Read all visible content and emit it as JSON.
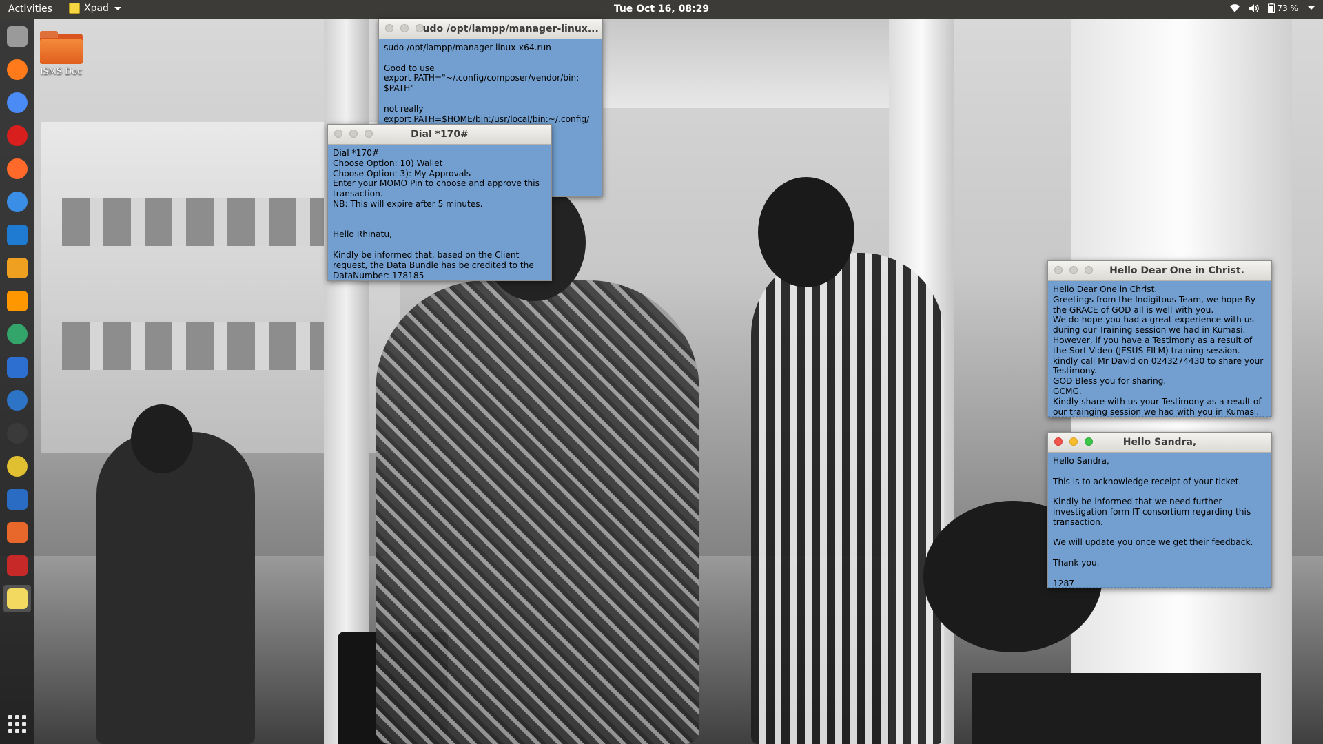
{
  "top_bar": {
    "activities": "Activities",
    "app_name": "Xpad",
    "clock": "Tue Oct 16, 08:29",
    "battery": "73 %",
    "icons": [
      "wifi-icon",
      "volume-icon",
      "battery-icon",
      "system-menu-caret-icon"
    ]
  },
  "dock": {
    "items": [
      {
        "name": "files",
        "color": "#9a9a9a"
      },
      {
        "name": "firefox",
        "color": "#ff7a1a"
      },
      {
        "name": "chrome",
        "color": "#4b8bf5"
      },
      {
        "name": "opera",
        "color": "#d91e1e"
      },
      {
        "name": "brave-compass",
        "color": "#ff6a2b"
      },
      {
        "name": "remmina",
        "color": "#3a8ee6"
      },
      {
        "name": "vscode",
        "color": "#1f7ad1"
      },
      {
        "name": "layers-app",
        "color": "#f0a020"
      },
      {
        "name": "sublime-text",
        "color": "#ff9800"
      },
      {
        "name": "network-app",
        "color": "#33a56b"
      },
      {
        "name": "system-monitor",
        "color": "#2c6fd1"
      },
      {
        "name": "thunderbird",
        "color": "#2d74c7"
      },
      {
        "name": "inkscape",
        "color": "#3a3a3a"
      },
      {
        "name": "rhythmbox",
        "color": "#e0c030"
      },
      {
        "name": "libreoffice-writer",
        "color": "#2a6cc4"
      },
      {
        "name": "software-center",
        "color": "#e8672a"
      },
      {
        "name": "screen-recorder",
        "color": "#c72828"
      },
      {
        "name": "xpad",
        "color": "#f3d960"
      }
    ],
    "show_apps": "show-applications-icon"
  },
  "desktop": {
    "folder_label": "ISMS Doc"
  },
  "notes": [
    {
      "id": "note-sudo",
      "title": "sudo /opt/lampp/manager-linux...",
      "body": "sudo /opt/lampp/manager-linux-x64.run\n\nGood to use\nexport PATH=\"~/.config/composer/vendor/bin:\n$PATH\"\n\nnot really\nexport PATH=$HOME/bin:/usr/local/bin:~/.config/"
    },
    {
      "id": "note-dial",
      "title": "Dial *170#",
      "body": "Dial *170#\nChoose Option: 10) Wallet\nChoose Option: 3): My Approvals\nEnter your MOMO Pin to choose and approve this\ntransaction.\nNB: This will expire after 5 minutes.\n\n\nHello Rhinatu,\n\nKindly be informed that, based on the Client\nrequest, the Data Bundle has be credited to the\nDataNumber: 178185"
    },
    {
      "id": "note-christ",
      "title": "Hello Dear One in Christ.",
      "body": "Hello Dear One in Christ.\nGreetings from the Indigitous Team, we hope By\nthe GRACE of GOD all is well with you.\nWe do hope you had a great experience with us\nduring our Training session we had in Kumasi.\nHowever, if you have a Testimony as a result of\nthe Sort Video (JESUS FILM) training session.\nkindly call Mr David on 0243274430 to share your\nTestimony.\nGOD Bless you for sharing.\nGCMG.\nKindly share with us your Testimony as a result of\nour trainging session we had with you in Kumasi."
    },
    {
      "id": "note-sandra",
      "title": "Hello Sandra,",
      "body": "Hello Sandra,\n\nThis is to acknowledge receipt of your ticket.\n\nKindly be informed that we need further\ninvestigation form IT consortium regarding this\ntransaction.\n\nWe will update you once we get their feedback.\n\nThank you.\n\n1287"
    }
  ]
}
